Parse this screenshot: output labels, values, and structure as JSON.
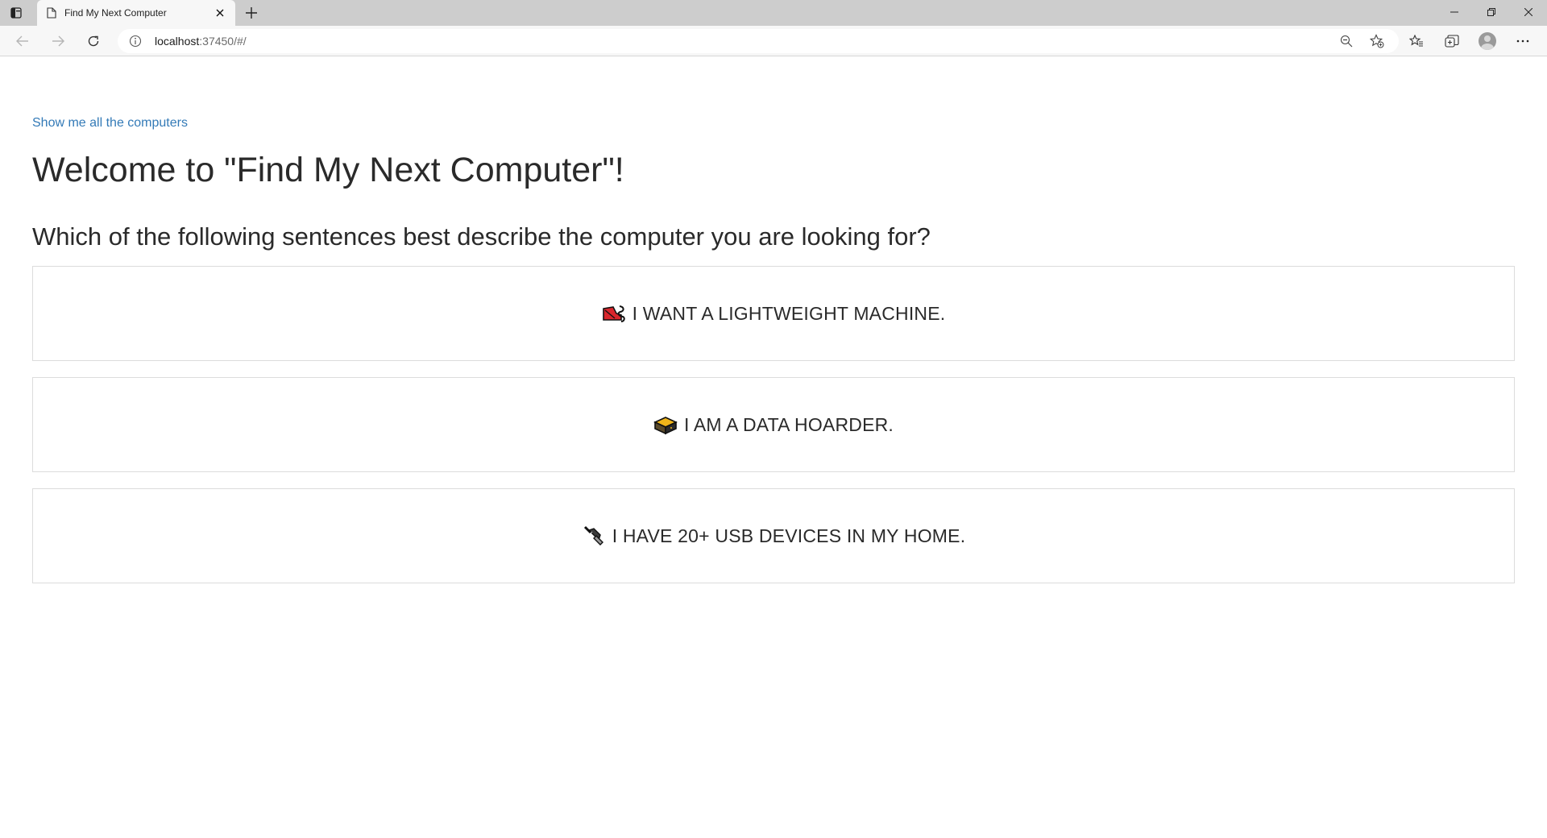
{
  "browser": {
    "tab_title": "Find My Next Computer",
    "new_tab_symbol": "+",
    "url_host": "localhost",
    "url_rest": ":37450/#/"
  },
  "page": {
    "all_link": "Show me all the computers",
    "welcome": "Welcome to \"Find My Next Computer\"!",
    "question": "Which of the following sentences best describe the computer you are looking for?",
    "options": [
      {
        "icon": "running-shoe-icon",
        "label": "I WANT A LIGHTWEIGHT MACHINE."
      },
      {
        "icon": "hard-drive-icon",
        "label": "I AM A DATA HOARDER."
      },
      {
        "icon": "usb-plug-icon",
        "label": "I HAVE 20+ USB DEVICES IN MY HOME."
      }
    ]
  },
  "colors": {
    "link": "#337ab7",
    "text": "#2a2a2a",
    "tabbar": "#cdcdcd",
    "toolbar": "#f7f7f7"
  }
}
